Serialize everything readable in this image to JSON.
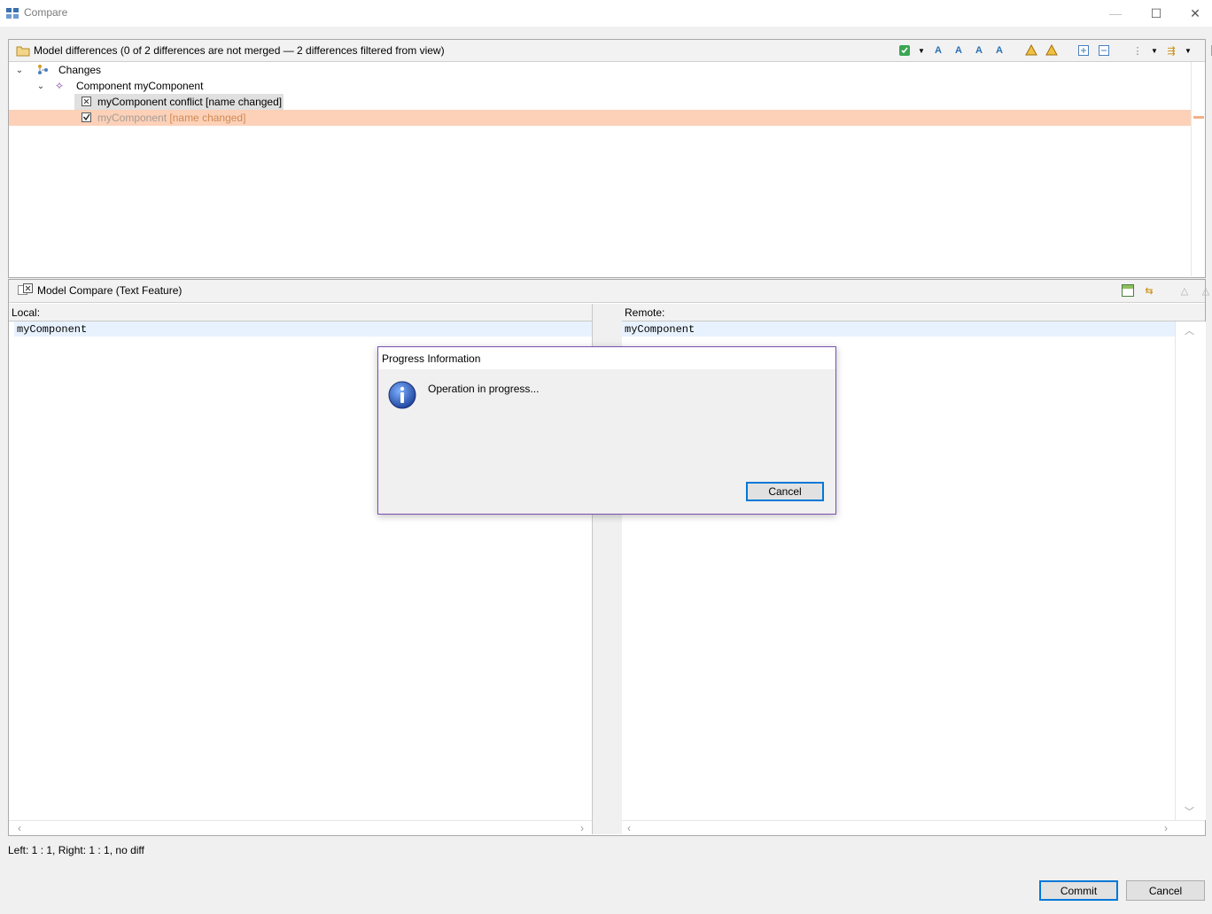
{
  "window": {
    "title": "Compare",
    "minimize": "—",
    "maximize": "☐",
    "close": "✕"
  },
  "model_differences": {
    "title": "Model differences  (0 of 2 differences are not merged — 2 differences filtered from view)",
    "tree": {
      "root": "Changes",
      "component": "Component myComponent",
      "items": [
        {
          "label": "myComponent conflict [name changed]",
          "state": "selected"
        },
        {
          "label_name": "myComponent",
          "label_tag": " [name changed]",
          "state": "highlighted"
        }
      ]
    },
    "colors": {
      "highlight": "#fcd1b8",
      "highlight_text": "#d08a55",
      "selected": "#e0e0e0"
    }
  },
  "model_compare": {
    "title": "Model Compare (Text Feature)",
    "local_label": "Local:",
    "remote_label": "Remote:",
    "local_value": "myComponent",
    "remote_value": "myComponent"
  },
  "dialog": {
    "title": "Progress Information",
    "message": "Operation in progress...",
    "cancel": "Cancel"
  },
  "status": {
    "text": "Left: 1 : 1, Right: 1 : 1, no diff"
  },
  "footer": {
    "commit": "Commit",
    "cancel": "Cancel"
  }
}
